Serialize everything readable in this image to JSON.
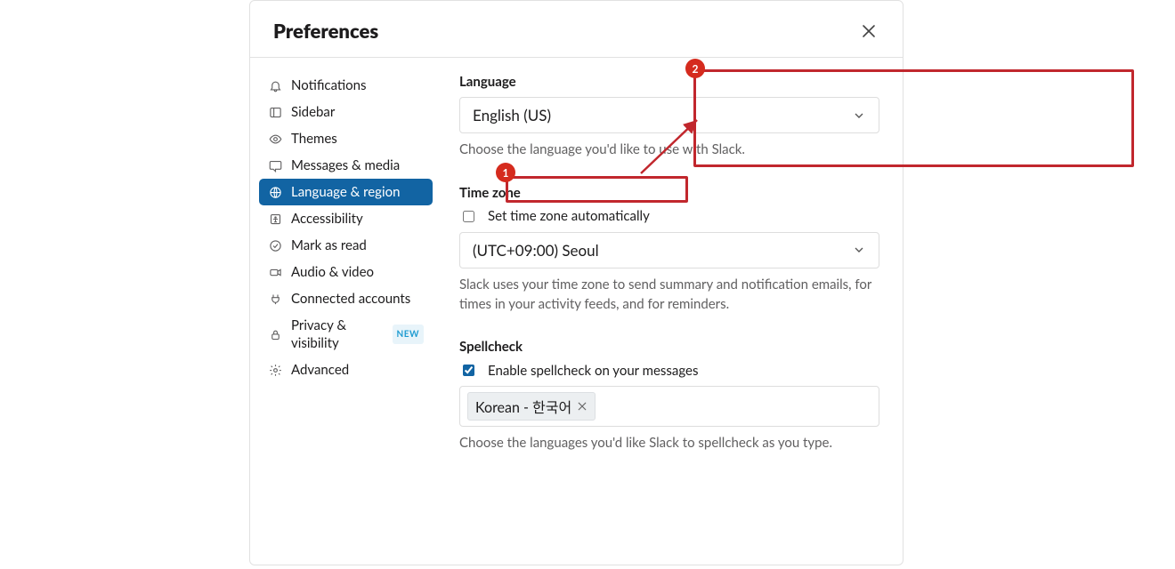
{
  "header": {
    "title": "Preferences"
  },
  "sidebar": {
    "items": [
      {
        "label": "Notifications",
        "icon": "bell-icon",
        "active": false
      },
      {
        "label": "Sidebar",
        "icon": "sidebar-icon",
        "active": false
      },
      {
        "label": "Themes",
        "icon": "eye-icon",
        "active": false
      },
      {
        "label": "Messages & media",
        "icon": "chat-icon",
        "active": false
      },
      {
        "label": "Language & region",
        "icon": "globe-icon",
        "active": true
      },
      {
        "label": "Accessibility",
        "icon": "person-icon",
        "active": false
      },
      {
        "label": "Mark as read",
        "icon": "check-circle-icon",
        "active": false
      },
      {
        "label": "Audio & video",
        "icon": "camera-icon",
        "active": false
      },
      {
        "label": "Connected accounts",
        "icon": "plug-icon",
        "active": false
      },
      {
        "label": "Privacy & visibility",
        "icon": "lock-icon",
        "active": false,
        "badge": "NEW"
      },
      {
        "label": "Advanced",
        "icon": "gear-icon",
        "active": false
      }
    ]
  },
  "language": {
    "label": "Language",
    "selected": "English (US)",
    "helper": "Choose the language you'd like to use with Slack."
  },
  "timezone": {
    "label": "Time zone",
    "auto_label": "Set time zone automatically",
    "auto_checked": false,
    "selected": "(UTC+09:00) Seoul",
    "helper": "Slack uses your time zone to send summary and notification emails, for times in your activity feeds, and for reminders."
  },
  "spellcheck": {
    "label": "Spellcheck",
    "enable_label": "Enable spellcheck on your messages",
    "enable_checked": true,
    "tags": [
      "Korean - 한국어"
    ],
    "helper": "Choose the languages you'd like Slack to spellcheck as you type."
  },
  "annotations": {
    "step1": "1",
    "step2": "2"
  }
}
